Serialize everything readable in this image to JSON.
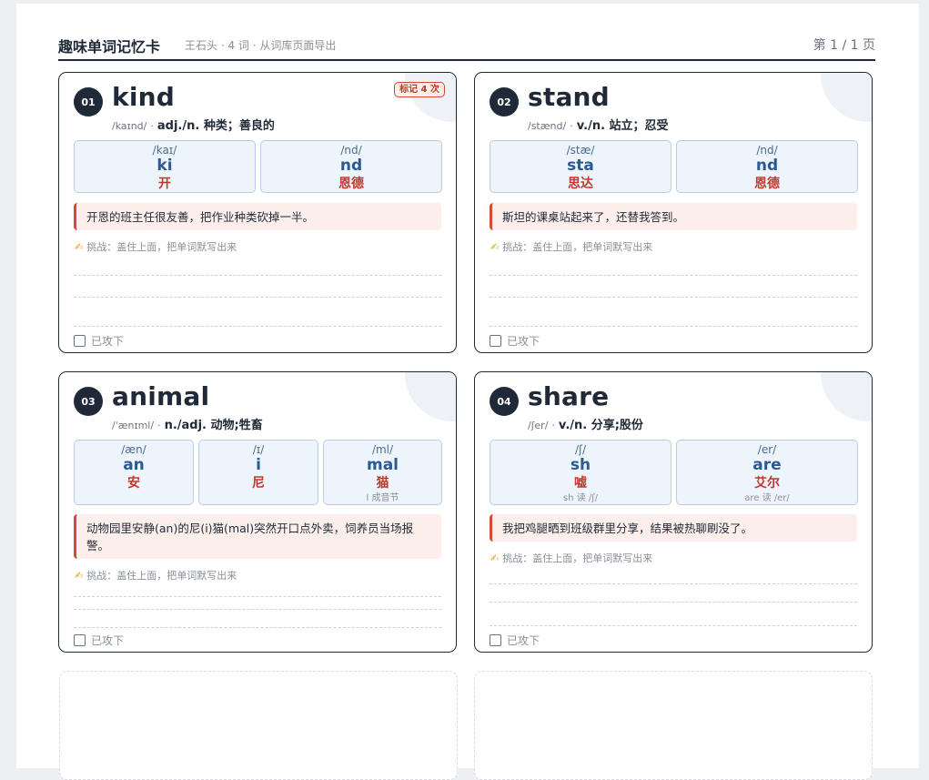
{
  "header": {
    "title": "趣味单词记忆卡",
    "meta": "王石头 · 4 词 · 从词库页面导出",
    "page": "第 1 / 1 页"
  },
  "challenge_text": "挑战：盖住上面，把单词默写出来",
  "done_label": "已攻下",
  "icons": {
    "challenge": "pencil-hand-icon",
    "done": "checkbox-icon"
  },
  "colors": {
    "accent_red": "#c0392b",
    "accent_blue": "#2a5a96",
    "ink": "#1f2937"
  },
  "cards": [
    {
      "num": "01",
      "word": "kind",
      "phonetic": "/kaɪnd/",
      "definition": "adj./n. 种类；善良的",
      "badge": "标记 4 次",
      "syllables": [
        {
          "ipa": "/kaɪ/",
          "letters": "ki",
          "cn": "开"
        },
        {
          "ipa": "/nd/",
          "letters": "nd",
          "cn": "恩德"
        }
      ],
      "story": "开恩的班主任很友善，把作业种类砍掉一半。"
    },
    {
      "num": "02",
      "word": "stand",
      "phonetic": "/stænd/",
      "definition": "v./n. 站立；忍受",
      "syllables": [
        {
          "ipa": "/stæ/",
          "letters": "sta",
          "cn": "思达"
        },
        {
          "ipa": "/nd/",
          "letters": "nd",
          "cn": "恩德"
        }
      ],
      "story": "斯坦的课桌站起来了，还替我答到。"
    },
    {
      "num": "03",
      "word": "animal",
      "phonetic": "/ˈænɪml/",
      "definition": "n./adj. 动物;牲畜",
      "syllables": [
        {
          "ipa": "/æn/",
          "letters": "an",
          "cn": "安"
        },
        {
          "ipa": "/ɪ/",
          "letters": "i",
          "cn": "尼"
        },
        {
          "ipa": "/ml/",
          "letters": "mal",
          "cn": "猫",
          "note": "l 成音节"
        }
      ],
      "story": "动物园里安静(an)的尼(i)猫(mal)突然开口点外卖，饲养员当场报警。"
    },
    {
      "num": "04",
      "word": "share",
      "phonetic": "/ʃer/",
      "definition": "v./n. 分享;股份",
      "syllables": [
        {
          "ipa": "/ʃ/",
          "letters": "sh",
          "cn": "嘘",
          "note": "sh 读 /ʃ/"
        },
        {
          "ipa": "/er/",
          "letters": "are",
          "cn": "艾尔",
          "note": "are 读 /er/"
        }
      ],
      "story": "我把鸡腿晒到班级群里分享，结果被热聊刷没了。"
    }
  ]
}
